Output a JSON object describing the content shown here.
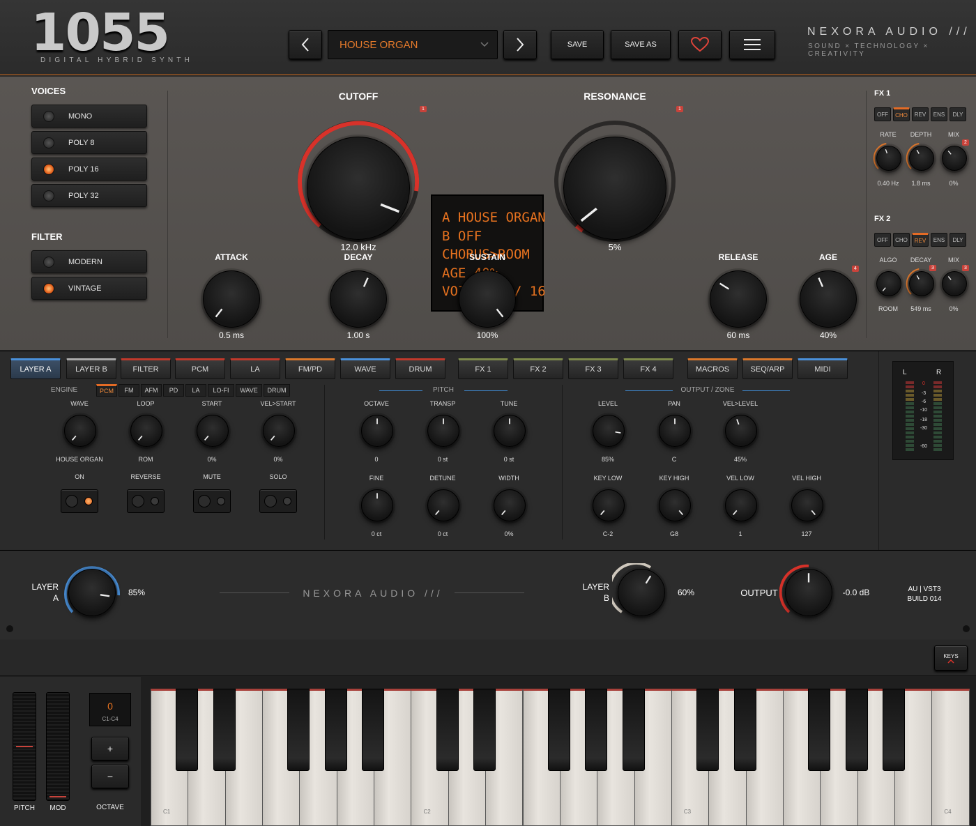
{
  "header": {
    "logo_number": "1055",
    "logo_subtitle": "DIGITAL HYBRID SYNTH",
    "preset_name": "HOUSE ORGAN",
    "save_label": "SAVE",
    "save_as_label": "SAVE AS",
    "brand_name": "NEXORA AUDIO ///",
    "brand_tagline": "SOUND × TECHNOLOGY × CREATIVITY"
  },
  "voices": {
    "title": "VOICES",
    "items": [
      {
        "label": "MONO",
        "active": false
      },
      {
        "label": "POLY 8",
        "active": false
      },
      {
        "label": "POLY 16",
        "active": true
      },
      {
        "label": "POLY 32",
        "active": false
      }
    ]
  },
  "filter": {
    "title": "FILTER",
    "items": [
      {
        "label": "MODERN",
        "active": false
      },
      {
        "label": "VINTAGE",
        "active": true
      }
    ]
  },
  "main_knobs": {
    "cutoff": {
      "label": "CUTOFF",
      "value": "12.0 kHz",
      "badge": "1"
    },
    "resonance": {
      "label": "RESONANCE",
      "value": "5%",
      "badge": "1"
    },
    "attack": {
      "label": "ATTACK",
      "value": "0.5 ms"
    },
    "decay": {
      "label": "DECAY",
      "value": "1.00 s"
    },
    "sustain": {
      "label": "SUSTAIN",
      "value": "100%"
    },
    "release": {
      "label": "RELEASE",
      "value": "60 ms"
    },
    "age": {
      "label": "AGE",
      "value": "40%",
      "badge": "4"
    }
  },
  "lcd": {
    "lines": [
      "A HOUSE ORGAN",
      "B OFF",
      "CHORUS>ROOM",
      "AGE 40%",
      "VOICES 0 / 16"
    ]
  },
  "fx1": {
    "title": "FX 1",
    "buttons": [
      "OFF",
      "CHO",
      "REV",
      "ENS",
      "DLY"
    ],
    "active": "CHO",
    "knobs": [
      {
        "label": "RATE",
        "value": "0.40 Hz"
      },
      {
        "label": "DEPTH",
        "value": "1.8 ms"
      },
      {
        "label": "MIX",
        "value": "0%",
        "badge": "2"
      }
    ]
  },
  "fx2": {
    "title": "FX 2",
    "buttons": [
      "OFF",
      "CHO",
      "REV",
      "ENS",
      "DLY"
    ],
    "active": "REV",
    "knobs": [
      {
        "label": "ALGO",
        "value": "ROOM"
      },
      {
        "label": "DECAY",
        "value": "549 ms",
        "badge": "3"
      },
      {
        "label": "MIX",
        "value": "0%",
        "badge": "3"
      }
    ]
  },
  "tabs": [
    "LAYER A",
    "LAYER B",
    "FILTER",
    "PCM",
    "LA",
    "FM/PD",
    "WAVE",
    "DRUM",
    "FX 1",
    "FX 2",
    "FX 3",
    "FX 4",
    "MACROS",
    "SEQ/ARP",
    "MIDI"
  ],
  "tab_colors": [
    "#4a90d9",
    "#aaaaaa",
    "#c0392b",
    "#c0392b",
    "#c0392b",
    "#d9772b",
    "#4a90d9",
    "#c0392b",
    "#7d8a4a",
    "#7d8a4a",
    "#7d8a4a",
    "#7d8a4a",
    "#d9772b",
    "#d9772b",
    "#4a90d9"
  ],
  "engine": {
    "label": "ENGINE",
    "tabs": [
      "PCM",
      "FM",
      "AFM",
      "PD",
      "LA",
      "LO-FI",
      "WAVE",
      "DRUM"
    ],
    "active": "PCM"
  },
  "engine_knobs": [
    {
      "label": "WAVE",
      "value": "HOUSE ORGAN"
    },
    {
      "label": "LOOP",
      "value": "ROM"
    },
    {
      "label": "START",
      "value": "0%"
    },
    {
      "label": "VEL>START",
      "value": "0%"
    }
  ],
  "switches": [
    {
      "label": "ON",
      "on": true
    },
    {
      "label": "REVERSE",
      "on": false
    },
    {
      "label": "MUTE",
      "on": false
    },
    {
      "label": "SOLO",
      "on": false
    }
  ],
  "pitch": {
    "title": "PITCH",
    "row1": [
      {
        "label": "OCTAVE",
        "value": "0"
      },
      {
        "label": "TRANSP",
        "value": "0 st"
      },
      {
        "label": "TUNE",
        "value": "0 st"
      }
    ],
    "row2": [
      {
        "label": "FINE",
        "value": "0 ct"
      },
      {
        "label": "DETUNE",
        "value": "0 ct"
      },
      {
        "label": "WIDTH",
        "value": "0%"
      }
    ]
  },
  "output": {
    "title": "OUTPUT / ZONE",
    "row1": [
      {
        "label": "LEVEL",
        "value": "85%"
      },
      {
        "label": "PAN",
        "value": "C"
      },
      {
        "label": "VEL>LEVEL",
        "value": "45%"
      }
    ],
    "row2": [
      {
        "label": "KEY LOW",
        "value": "C-2"
      },
      {
        "label": "KEY HIGH",
        "value": "G8"
      },
      {
        "label": "VEL LOW",
        "value": "1"
      },
      {
        "label": "VEL HIGH",
        "value": "127"
      }
    ]
  },
  "meter": {
    "left": "L",
    "right": "R",
    "scale": [
      "0",
      "-3",
      "-6",
      "-10",
      "-18",
      "-30",
      "-60"
    ]
  },
  "bottom": {
    "layer_a_label_1": "LAYER",
    "layer_a_label_2": "A",
    "layer_a_value": "85%",
    "brand_center": "NEXORA AUDIO ///",
    "layer_b_label_1": "LAYER",
    "layer_b_label_2": "B",
    "layer_b_value": "60%",
    "output_label": "OUTPUT",
    "output_value": "-0.0 dB",
    "format_1": "AU | VST3",
    "format_2": "BUILD 014"
  },
  "keyboard": {
    "keys_button": "KEYS",
    "pitch_label": "PITCH",
    "mod_label": "MOD",
    "octave_label": "OCTAVE",
    "octave_value": "0",
    "octave_range": "C1-C4",
    "plus": "+",
    "minus": "−",
    "note_labels": [
      "C1",
      "C2",
      "C3",
      "C4"
    ]
  }
}
